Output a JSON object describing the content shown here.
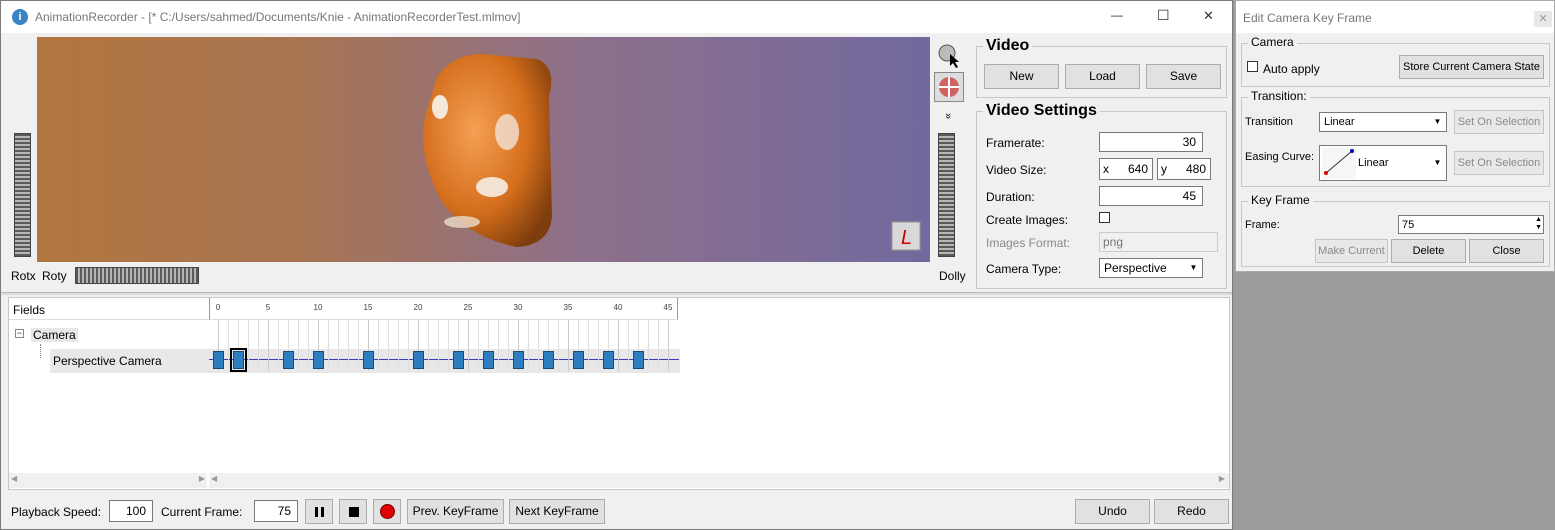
{
  "main_window": {
    "title": "AnimationRecorder - [* C:/Users/sahmed/Documents/Knie - AnimationRecorderTest.mlmov]",
    "minimize": "—",
    "maximize": "☐",
    "close": "✕"
  },
  "viewer": {
    "left_labels": [
      "Rotx",
      "Roty"
    ],
    "right_label": "Dolly",
    "chevron": "»"
  },
  "video": {
    "title": "Video",
    "new_label": "New",
    "load_label": "Load",
    "save_label": "Save"
  },
  "video_settings": {
    "title": "Video Settings",
    "framerate_label": "Framerate:",
    "framerate": "30",
    "video_size_label": "Video Size:",
    "x_label": "x",
    "width": "640",
    "y_label": "y",
    "height": "480",
    "duration_label": "Duration:",
    "duration": "45",
    "create_images_label": "Create Images:",
    "images_format_label": "Images Format:",
    "images_format": "png",
    "camera_type_label": "Camera Type:",
    "camera_type": "Perspective"
  },
  "timeline": {
    "fields_header": "Fields",
    "tick_labels": [
      "0",
      "5",
      "10",
      "15",
      "20",
      "25",
      "30",
      "35",
      "40",
      "45"
    ],
    "tree_expand": "−",
    "tree_root": "Camera",
    "tree_child": "Perspective Camera",
    "keyframes": [
      0,
      2,
      7,
      10,
      15,
      20,
      24,
      27,
      30,
      33,
      36,
      39,
      42
    ],
    "selected_keyframe": 2
  },
  "footer": {
    "playback_speed_label": "Playback Speed:",
    "playback_speed": "100",
    "current_frame_label": "Current Frame:",
    "current_frame": "75",
    "prev_keyframe_label": "Prev. KeyFrame",
    "next_keyframe_label": "Next KeyFrame",
    "undo_label": "Undo",
    "redo_label": "Redo",
    "scroll_left": "◀",
    "scroll_right": "▶"
  },
  "dialog": {
    "title": "Edit Camera Key Frame",
    "close": "✕",
    "camera_group": "Camera",
    "auto_apply_label": "Auto apply",
    "store_label": "Store Current Camera State",
    "transition_group": "Transition:",
    "transition_label": "Transition",
    "transition_value": "Linear",
    "set_on_selection_label": "Set On Selection",
    "easing_label": "Easing Curve:",
    "easing_value": "Linear",
    "keyframe_group": "Key Frame",
    "frame_label": "Frame:",
    "frame_value": "75",
    "make_current_label": "Make Current",
    "delete_label": "Delete",
    "close_label": "Close"
  },
  "colors": {
    "keyframe": "#2e7ebf",
    "record": "#e00000",
    "timeline_line": "#3b3bbf"
  }
}
